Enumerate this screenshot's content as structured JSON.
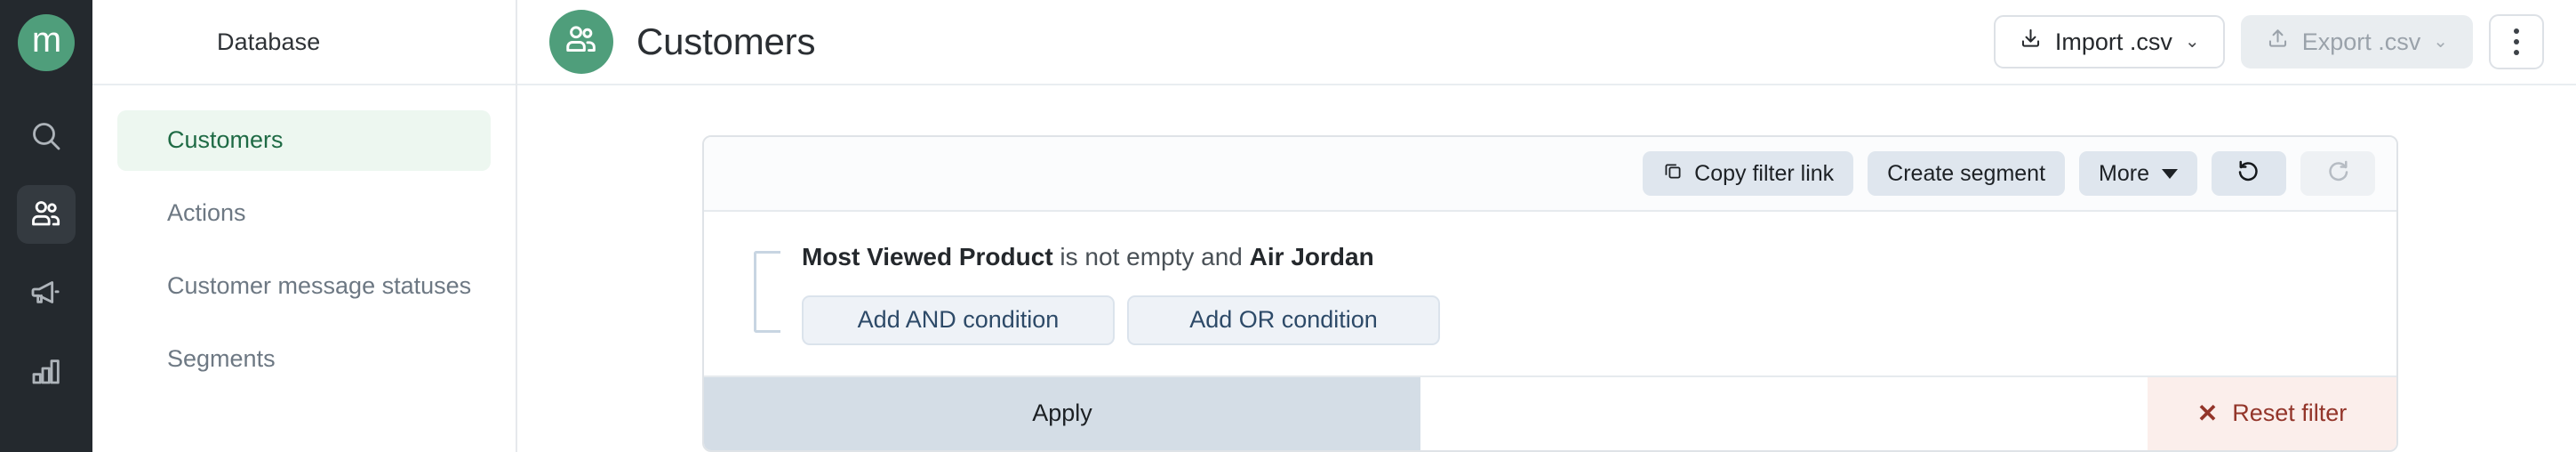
{
  "brand": {
    "logo_letter": "m",
    "logo_color": "#4f9e7b"
  },
  "icon_rail": {
    "items": [
      {
        "name": "search-icon",
        "label": "Search",
        "active": false
      },
      {
        "name": "customers-icon",
        "label": "Customers",
        "active": true
      },
      {
        "name": "megaphone-icon",
        "label": "Campaigns",
        "active": false
      },
      {
        "name": "bar-chart-icon",
        "label": "Analytics",
        "active": false
      }
    ]
  },
  "sidebar": {
    "title": "Database",
    "items": [
      {
        "label": "Customers",
        "active": true
      },
      {
        "label": "Actions",
        "active": false
      },
      {
        "label": "Customer message statuses",
        "active": false
      },
      {
        "label": "Segments",
        "active": false
      }
    ]
  },
  "header": {
    "avatar_icon": "customers-icon",
    "title": "Customers",
    "import_label": "Import .csv",
    "import_icon": "download-icon",
    "export_label": "Export .csv",
    "export_icon": "upload-icon",
    "caret": "⌄",
    "overflow_icon": "kebab-menu-icon"
  },
  "filter_panel": {
    "toolbar": {
      "copy_filter_link": "Copy filter link",
      "copy_icon": "copy-icon",
      "create_segment": "Create segment",
      "more_label": "More",
      "undo_icon": "undo-icon",
      "redo_icon": "redo-icon",
      "redo_disabled": true
    },
    "condition": {
      "field": "Most Viewed Product",
      "operator": "is not empty and",
      "value": "Air Jordan"
    },
    "add_and_label": "Add AND condition",
    "add_or_label": "Add OR condition",
    "apply_label": "Apply",
    "reset_label": "Reset filter",
    "reset_icon": "close-icon",
    "reset_color": "#93352a"
  }
}
